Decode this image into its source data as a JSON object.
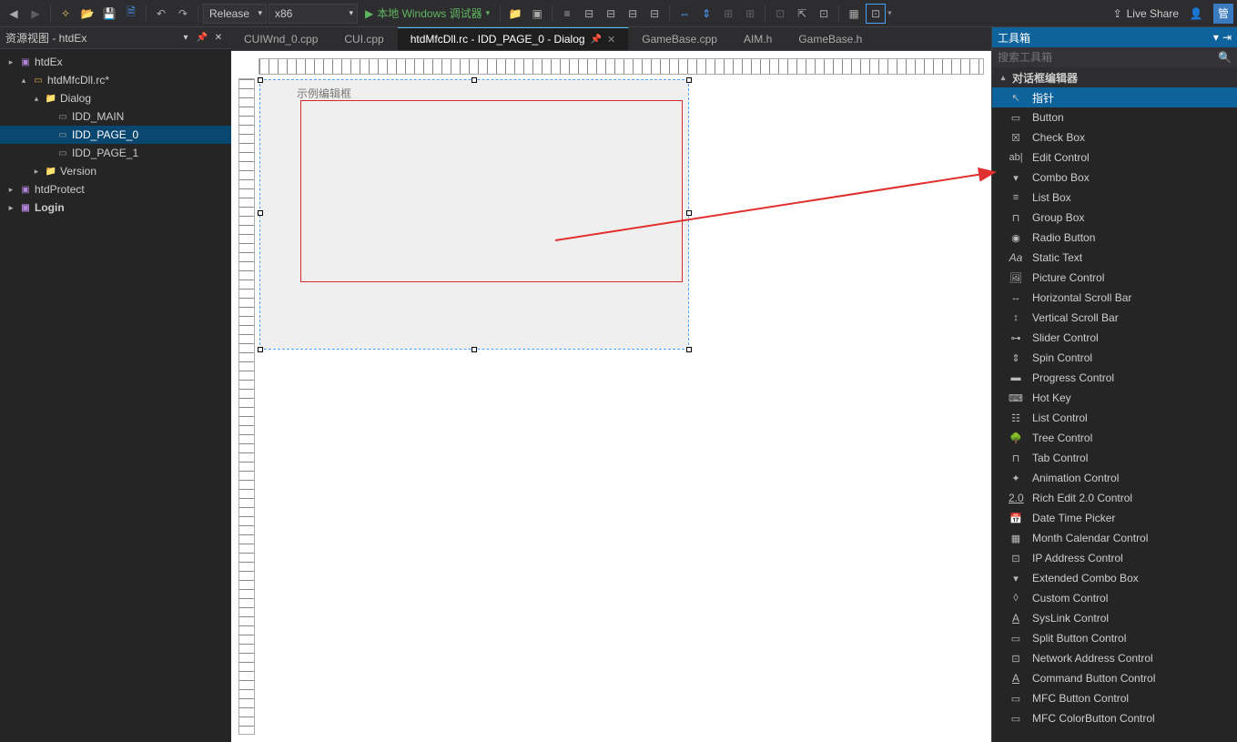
{
  "toolbar": {
    "config": "Release",
    "platform": "x86",
    "debugger": "本地 Windows 调试器",
    "live_share": "Live Share"
  },
  "left_panel": {
    "title": "资源视图 - htdEx",
    "tree": {
      "root": "htdEx",
      "rc": "htdMfcDll.rc*",
      "dialog_folder": "Dialog",
      "dlg_main": "IDD_MAIN",
      "dlg_p0": "IDD_PAGE_0",
      "dlg_p1": "IDD_PAGE_1",
      "version": "Version",
      "htdProtect": "htdProtect",
      "login": "Login"
    }
  },
  "tabs": {
    "t0": "CUIWnd_0.cpp",
    "t1": "CUI.cpp",
    "t2": "htdMfcDll.rc - IDD_PAGE_0 - Dialog",
    "t3": "GameBase.cpp",
    "t4": "AIM.h",
    "t5": "GameBase.h"
  },
  "designer": {
    "sample_edit_label": "示例编辑框"
  },
  "toolbox": {
    "title": "工具箱",
    "search_placeholder": "搜索工具箱",
    "category": "对话框编辑器",
    "items": {
      "pointer": "指针",
      "button": "Button",
      "checkbox": "Check Box",
      "edit": "Edit Control",
      "combo": "Combo Box",
      "listbox": "List Box",
      "groupbox": "Group Box",
      "radio": "Radio Button",
      "static": "Static Text",
      "picture": "Picture Control",
      "hscroll": "Horizontal Scroll Bar",
      "vscroll": "Vertical Scroll Bar",
      "slider": "Slider Control",
      "spin": "Spin Control",
      "progress": "Progress Control",
      "hotkey": "Hot Key",
      "listctrl": "List Control",
      "treectrl": "Tree Control",
      "tabctrl": "Tab Control",
      "animation": "Animation Control",
      "richedit2": "Rich Edit 2.0 Control",
      "datetime": "Date Time Picker",
      "monthcal": "Month Calendar Control",
      "ipaddr": "IP Address Control",
      "extcombo": "Extended Combo Box",
      "custom": "Custom Control",
      "syslink": "SysLink Control",
      "splitbtn": "Split Button Control",
      "netaddr": "Network Address Control",
      "cmdbtn": "Command Button Control",
      "mfcbtn": "MFC Button Control",
      "mfccolor": "MFC ColorButton Control"
    }
  }
}
